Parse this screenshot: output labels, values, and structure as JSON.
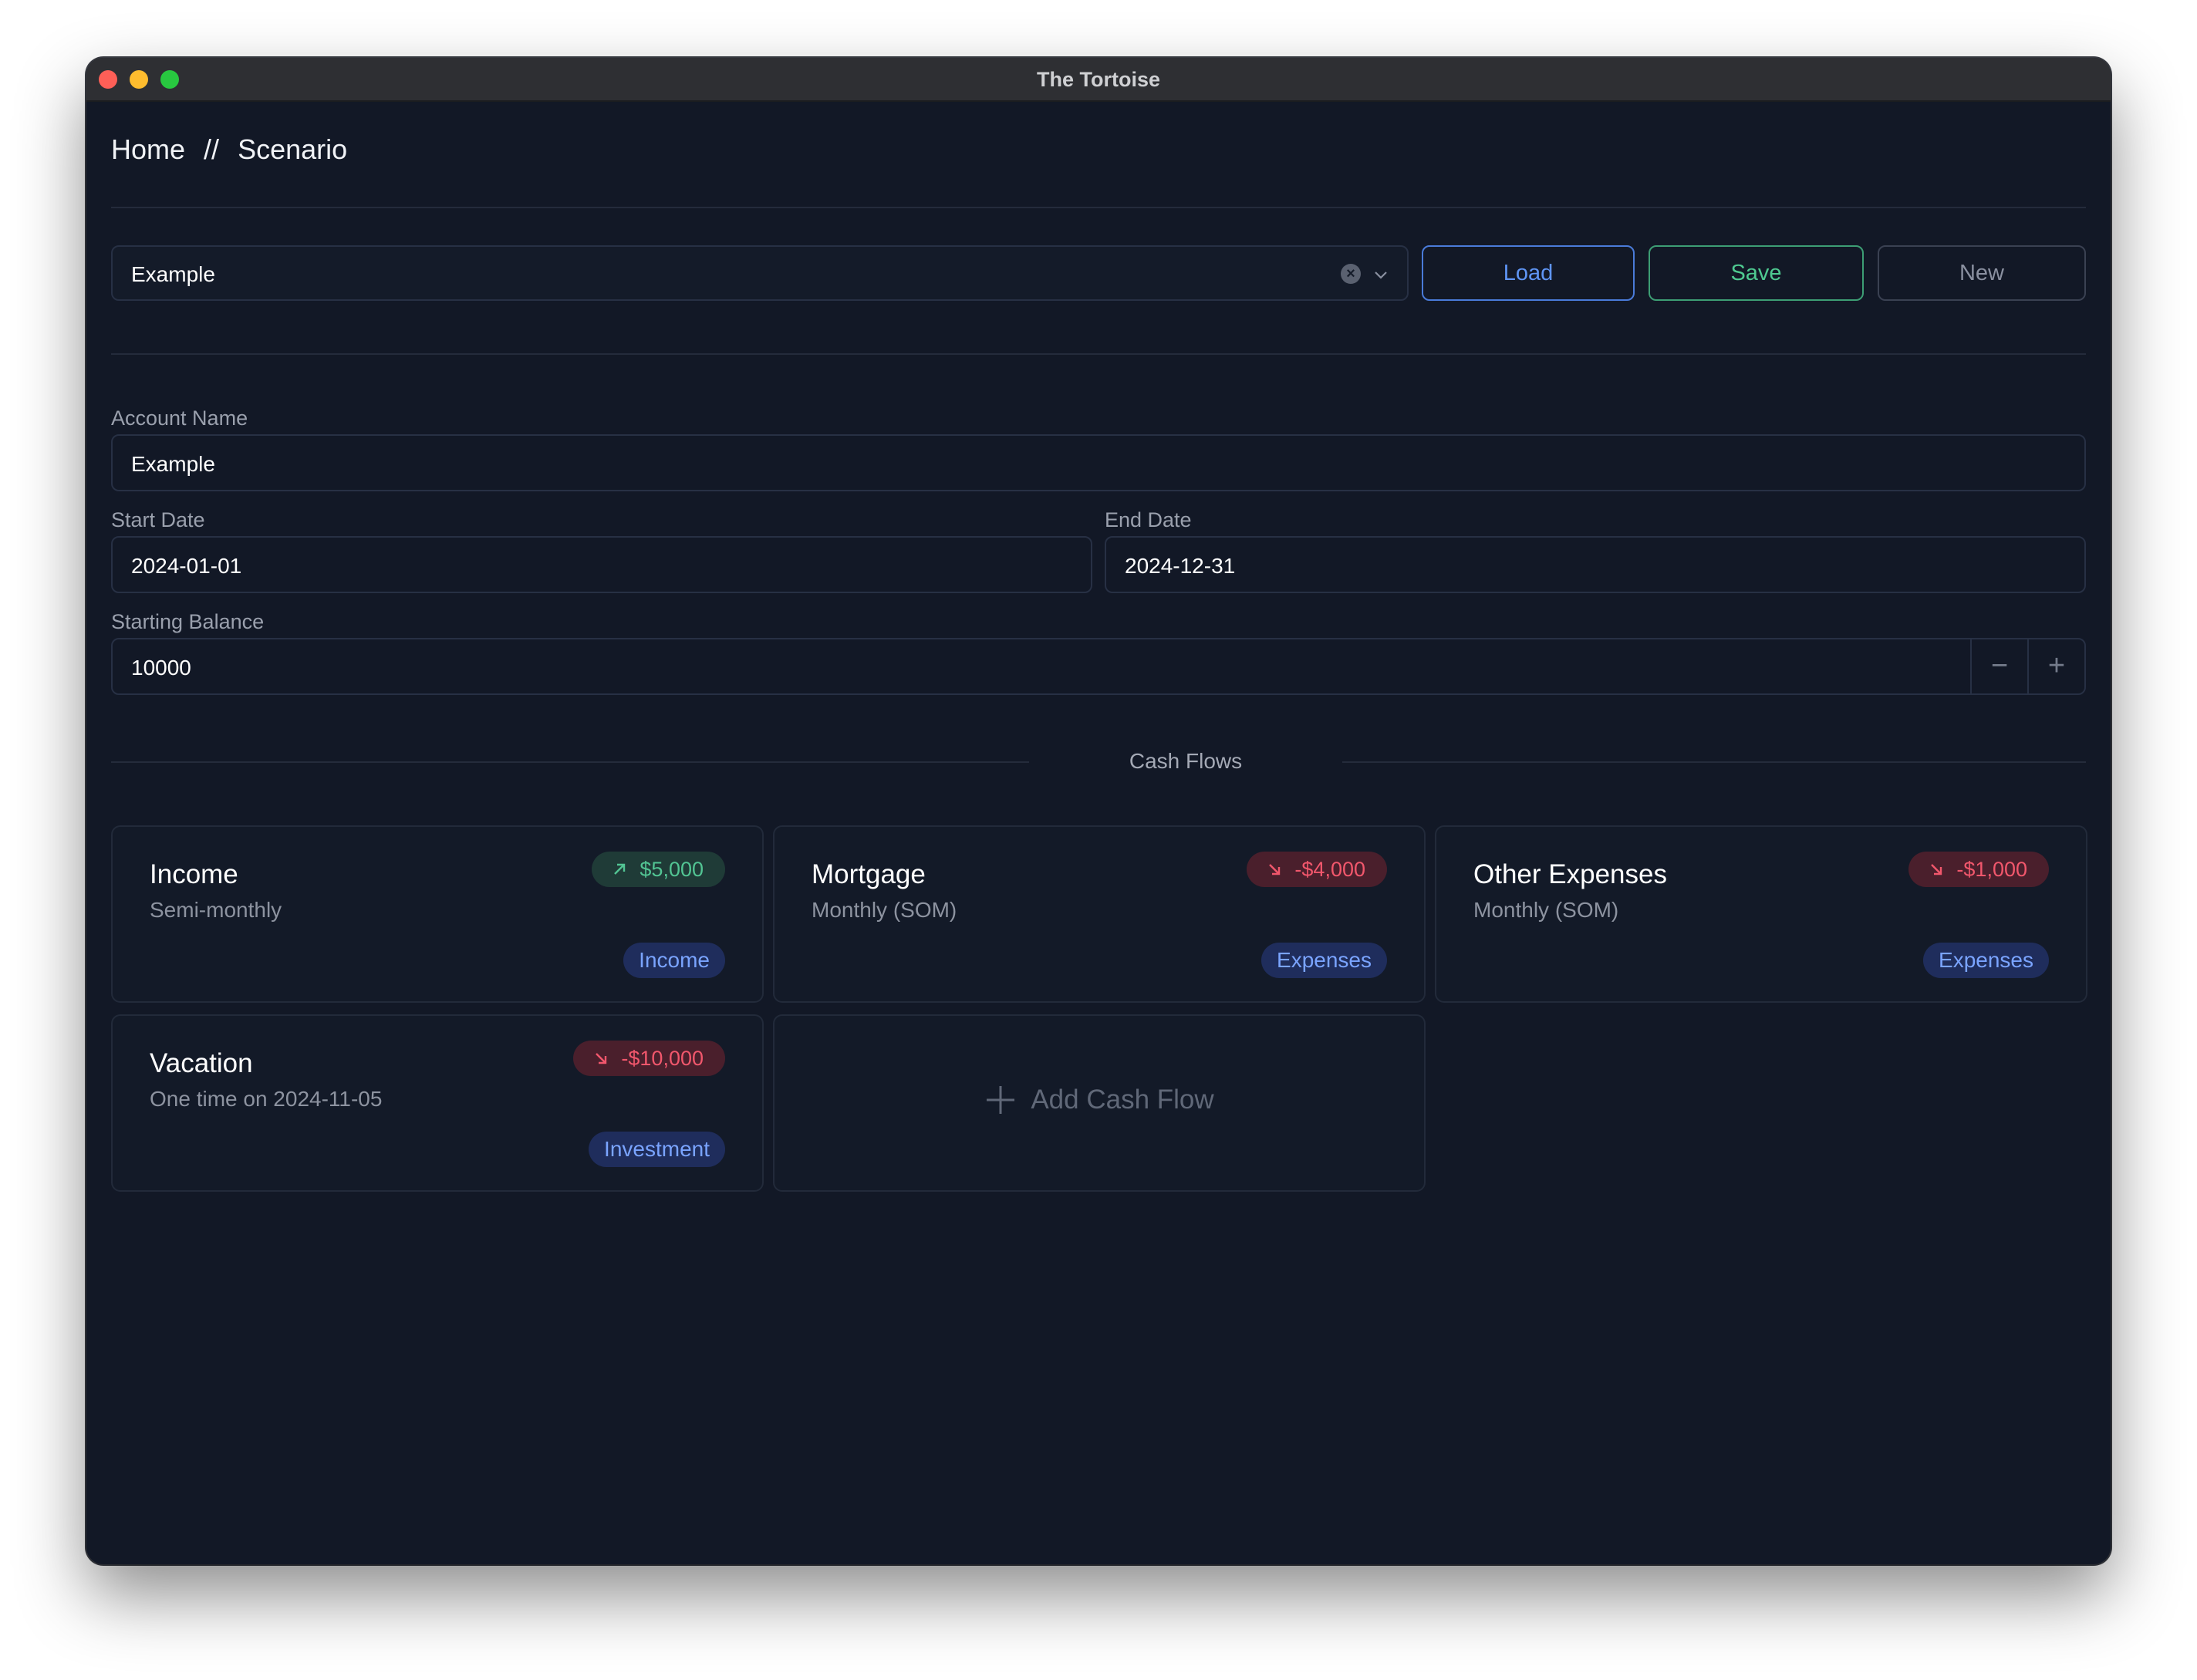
{
  "window": {
    "title": "The Tortoise"
  },
  "breadcrumb": {
    "home": "Home",
    "separator": "//",
    "current": "Scenario"
  },
  "scenario_select": {
    "value": "Example"
  },
  "toolbar": {
    "load_label": "Load",
    "save_label": "Save",
    "new_label": "New"
  },
  "form": {
    "account_name": {
      "label": "Account Name",
      "value": "Example"
    },
    "start_date": {
      "label": "Start Date",
      "value": "2024-01-01"
    },
    "end_date": {
      "label": "End Date",
      "value": "2024-12-31"
    },
    "starting_balance": {
      "label": "Starting Balance",
      "value": "10000",
      "decrement": "−",
      "increment": "+"
    }
  },
  "cash_flows": {
    "section_title": "Cash Flows",
    "items": [
      {
        "name": "Income",
        "schedule": "Semi-monthly",
        "amount": "$5,000",
        "direction": "up",
        "category": "Income"
      },
      {
        "name": "Mortgage",
        "schedule": "Monthly (SOM)",
        "amount": "-$4,000",
        "direction": "down",
        "category": "Expenses"
      },
      {
        "name": "Other Expenses",
        "schedule": "Monthly (SOM)",
        "amount": "-$1,000",
        "direction": "down",
        "category": "Expenses"
      },
      {
        "name": "Vacation",
        "schedule": "One time on 2024-11-05",
        "amount": "-$10,000",
        "direction": "down",
        "category": "Investment"
      }
    ],
    "add_label": "Add Cash Flow"
  },
  "colors": {
    "background": "#121826",
    "positive": "#52c493",
    "negative": "#f1576c",
    "tag": "#7aa4ff",
    "load": "#5f95f5",
    "save": "#4fca91"
  }
}
